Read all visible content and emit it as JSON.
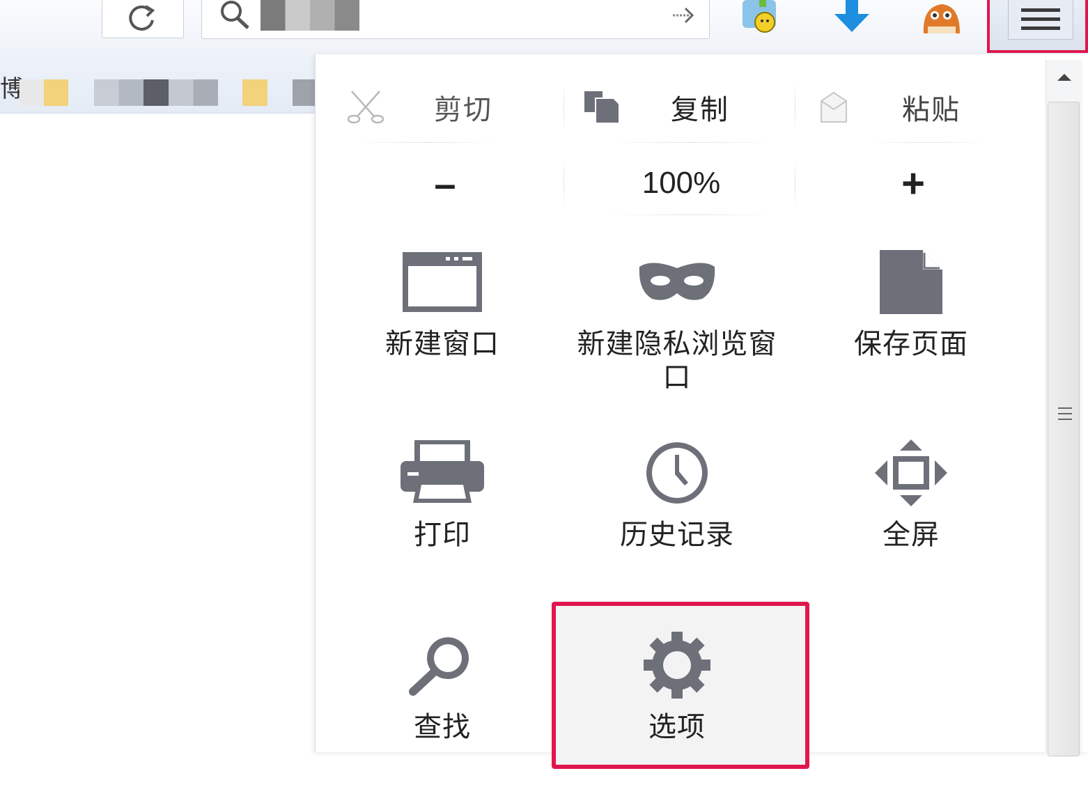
{
  "browser": {
    "bookmarks_bar": {
      "partial_text": "博"
    }
  },
  "edit_row": {
    "cut_label": "剪切",
    "copy_label": "复制",
    "paste_label": "粘贴"
  },
  "zoom_row": {
    "zoom_out_symbol": "–",
    "zoom_level": "100%",
    "zoom_in_symbol": "+"
  },
  "menu_items": [
    {
      "label": "新建窗口",
      "icon": "new-window-icon"
    },
    {
      "label": "新建隐私浏览窗口",
      "icon": "private-mask-icon"
    },
    {
      "label": "保存页面",
      "icon": "save-page-icon"
    },
    {
      "label": "打印",
      "icon": "printer-icon"
    },
    {
      "label": "历史记录",
      "icon": "clock-history-icon"
    },
    {
      "label": "全屏",
      "icon": "fullscreen-icon"
    },
    {
      "label": "查找",
      "icon": "magnifier-icon"
    },
    {
      "label": "选项",
      "icon": "gear-icon"
    }
  ],
  "colors": {
    "highlight": "#e0174e",
    "icon_gray": "#6d7079",
    "download_blue": "#1e8fe0"
  }
}
